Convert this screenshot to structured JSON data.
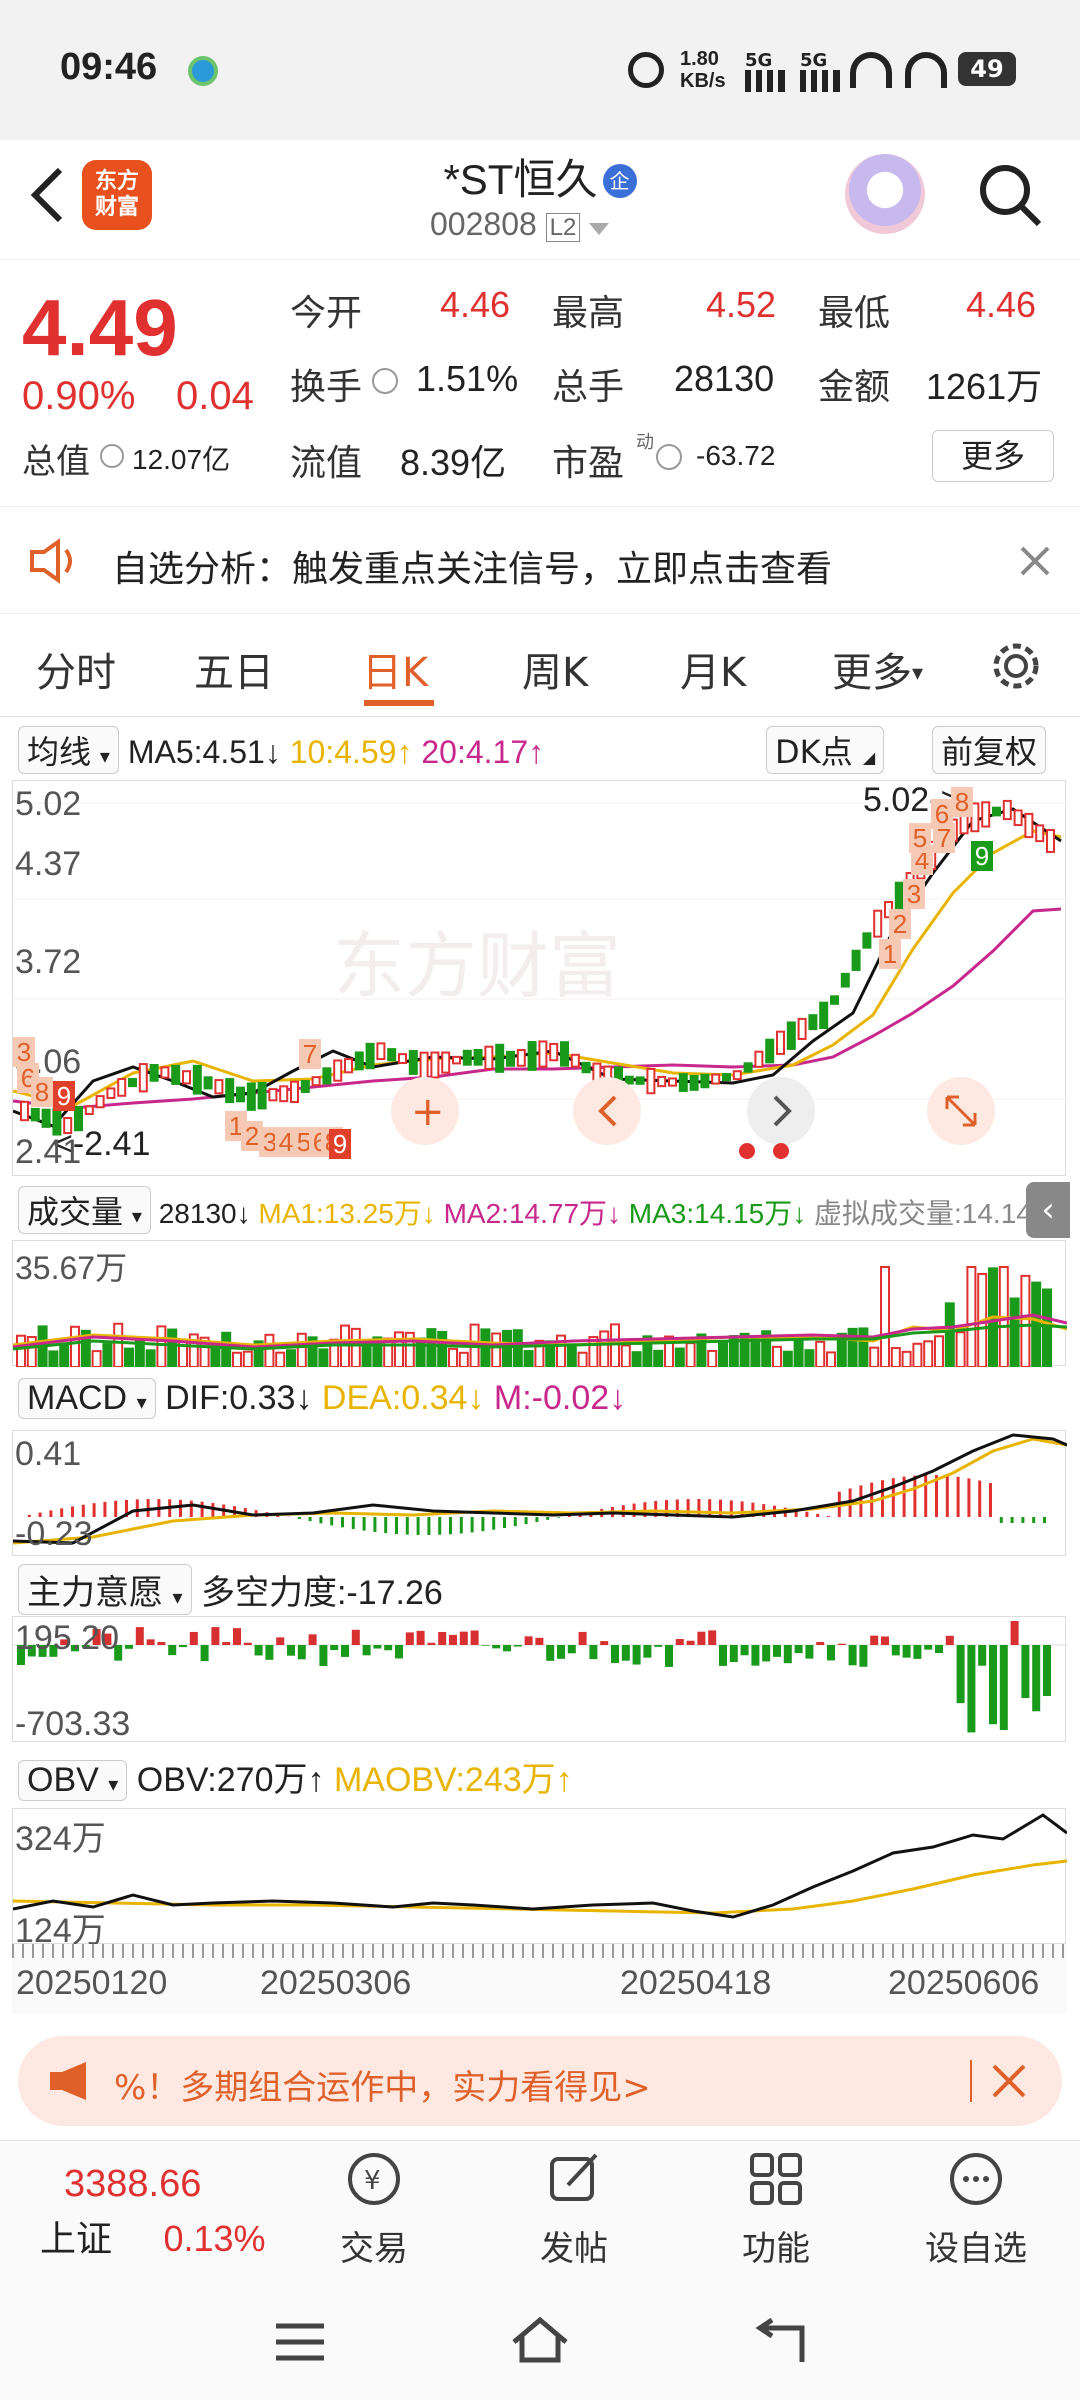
{
  "status": {
    "time": "09:46",
    "net_speed": "1.80\nKB/s",
    "net1": "5G",
    "net2": "5G",
    "battery": "49"
  },
  "header": {
    "back_label": "<",
    "logo_text": "东方\n财富",
    "title": "*ST恒久",
    "badge": "企",
    "code": "002808",
    "level": "L2"
  },
  "quote": {
    "price": "4.49",
    "pct": "0.90%",
    "chg": "0.04",
    "open_label": "今开",
    "open": "4.46",
    "high_label": "最高",
    "high": "4.52",
    "low_label": "最低",
    "low": "4.46",
    "turnover_label": "换手",
    "turnover": "1.51%",
    "volume_label": "总手",
    "volume": "28130",
    "amount_label": "金额",
    "amount": "1261万",
    "mktcap_label": "总值",
    "mktcap": "12.07亿",
    "float_label": "流值",
    "float": "8.39亿",
    "pe_label": "市盈",
    "pe_sup": "动",
    "pe": "-63.72",
    "more": "更多"
  },
  "notice": {
    "text": "自选分析：触发重点关注信号，立即点击查看"
  },
  "tabs": [
    {
      "label": "分时"
    },
    {
      "label": "五日"
    },
    {
      "label": "日K"
    },
    {
      "label": "周K"
    },
    {
      "label": "月K"
    },
    {
      "label": "更多"
    }
  ],
  "ma": {
    "select": "均线",
    "ma5": "MA5:4.51↓",
    "ma10": "10:4.59↑",
    "ma20": "20:4.17↑",
    "dk": "DK点",
    "adj": "前复权"
  },
  "kline": {
    "y_ticks": [
      "5.02",
      "4.37",
      "3.72",
      "3.06",
      "2.41"
    ],
    "max_label": "5.02->",
    "min_label": "<-2.41",
    "signals_right": [
      "1",
      "2",
      "3",
      "4",
      "5",
      "7",
      "6",
      "8",
      "9"
    ],
    "signals_left": [
      "3",
      "6",
      "8",
      "9"
    ],
    "signals_mid": [
      "1",
      "2",
      "3",
      "4",
      "5",
      "6",
      "8",
      "9"
    ],
    "sig7": "7"
  },
  "volume": {
    "select": "成交量",
    "vol": "28130↓",
    "ma1": "MA1:13.25万↓",
    "ma2": "MA2:14.77万↓",
    "ma3": "MA3:14.15万↓",
    "virt": "虚拟成交量:14.14万",
    "top": "35.67万"
  },
  "macd": {
    "select": "MACD",
    "dif": "DIF:0.33↓",
    "dea": "DEA:0.34↓",
    "m": "M:-0.02↓",
    "top": "0.41",
    "bottom": "-0.23"
  },
  "main_force": {
    "select": "主力意愿",
    "label": "多空力度:-17.26",
    "top": "195.20",
    "bottom": "-703.33"
  },
  "obv": {
    "select": "OBV",
    "obv": "OBV:270万↑",
    "maobv": "MAOBV:243万↑",
    "top": "324万",
    "bottom": "124万"
  },
  "dates": [
    "20250120",
    "20250306",
    "20250418",
    "20250606"
  ],
  "banner": {
    "text": "%！多期组合运作中，实力看得见>"
  },
  "bottom_nav": {
    "index_value": "3388.66",
    "index_name": "上证",
    "index_pct": "0.13%",
    "items": [
      {
        "label": "交易"
      },
      {
        "label": "发帖"
      },
      {
        "label": "功能"
      },
      {
        "label": "设自选"
      }
    ]
  },
  "colors": {
    "up": "#e03030",
    "down": "#1a9a1a",
    "accent": "#e0602a",
    "ma10": "#e8b400",
    "ma20": "#c8288c"
  }
}
